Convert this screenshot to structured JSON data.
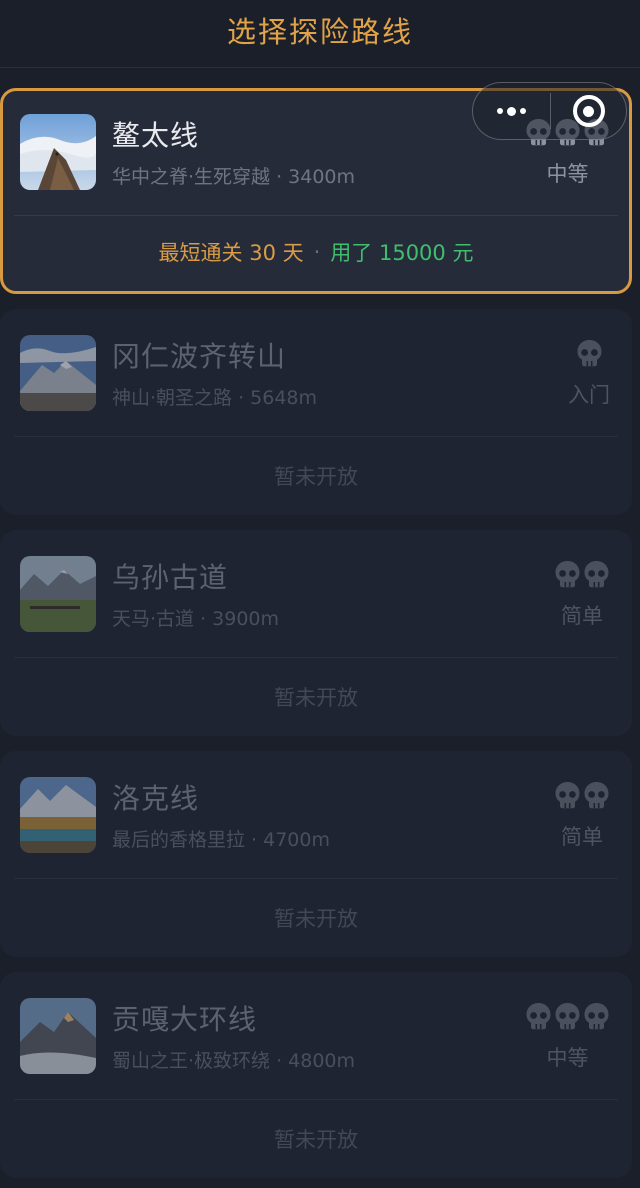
{
  "header": {
    "title": "选择探险路线"
  },
  "capsule": {
    "more_icon": "more-dots-icon",
    "close_icon": "target-ring-icon"
  },
  "routes": [
    {
      "name": "鳌太线",
      "desc": "华中之脊·生死穿越 · 3400m",
      "difficulty_label": "中等",
      "skull_count": 3,
      "footer": {
        "best_label": "最短通关 30 天",
        "separator": "·",
        "used_label": "用了 15000 元"
      },
      "status": "active"
    },
    {
      "name": "冈仁波齐转山",
      "desc": "神山·朝圣之路 · 5648m",
      "difficulty_label": "入门",
      "skull_count": 1,
      "footer_text": "暂未开放",
      "status": "locked"
    },
    {
      "name": "乌孙古道",
      "desc": "天马·古道 · 3900m",
      "difficulty_label": "简单",
      "skull_count": 2,
      "footer_text": "暂未开放",
      "status": "locked"
    },
    {
      "name": "洛克线",
      "desc": "最后的香格里拉 · 4700m",
      "difficulty_label": "简单",
      "skull_count": 2,
      "footer_text": "暂未开放",
      "status": "locked"
    },
    {
      "name": "贡嘎大环线",
      "desc": "蜀山之王·极致环绕 · 4800m",
      "difficulty_label": "中等",
      "skull_count": 3,
      "footer_text": "暂未开放",
      "status": "locked"
    }
  ],
  "colors": {
    "accent": "#d89a3f",
    "best_text": "#d99c45",
    "used_text": "#3fbf6e",
    "background": "#1b1f2a"
  }
}
